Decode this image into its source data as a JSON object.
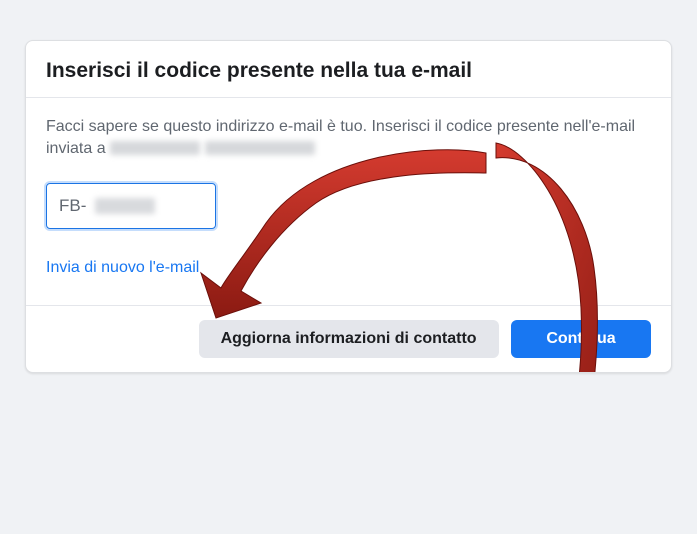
{
  "dialog": {
    "title": "Inserisci il codice presente nella tua e-mail",
    "instruction_part1": "Facci sapere se questo indirizzo e-mail è tuo. Inserisci il codice presente nell'e-mail inviata a ",
    "input_prefix": "FB-",
    "resend_label": "Invia di nuovo l'e-mail",
    "update_contact_label": "Aggiorna informazioni di contatto",
    "continue_label": "Continua"
  }
}
